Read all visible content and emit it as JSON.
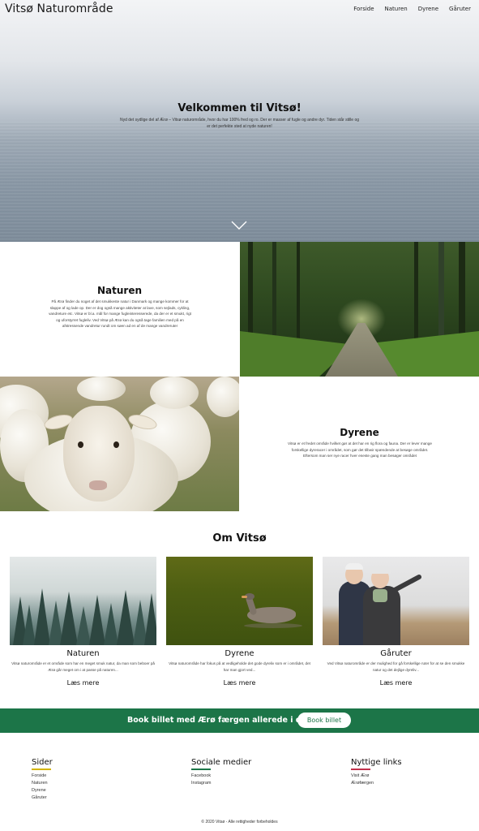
{
  "header": {
    "logo": "Vitsø Naturområde",
    "nav": [
      "Forside",
      "Naturen",
      "Dyrene",
      "Gåruter"
    ]
  },
  "hero": {
    "title": "Velkommen til Vitsø!",
    "subtitle": "Nyd det sydlige del af Ærø – Vitsø naturområde, hvor du har 100% fred og ro. Der er masser af fugle og andre dyr. Tiden står stille og er det perfekte sted at nyde naturen!"
  },
  "naturen": {
    "title": "Naturen",
    "text": "På Ærø finder du noget af det smukkeste natur i Danmark og mange kommer for at slappe af og lade op. Der er dog også mange aktiviteter at lave, som sejlads, cykling, vandreture etc. Vitsø er bl.a. mål for mange fugleinteresserede, da der er et smukt, rigt og uforstyrret fugleliv. Ved Vitsø på Ærø kan du også tage familien med på en afstressende vandretur rundt om søen ad en af de mange vandreruter"
  },
  "dyrene": {
    "title": "Dyrene",
    "text": "Vitsø er et fredet område hvilket gør at det har en rig flora og fauna. Der er lever mange forskellige dyreracer i området, som gør det tilbwir spændende at besøge området. Eftersom man ser nye racer hver eneste gang man besøger området"
  },
  "om": {
    "title": "Om Vitsø",
    "cards": [
      {
        "title": "Naturen",
        "text": "Vitsø naturområde er et område som har en meget smuk natur, da man som beboer på Ærø går meget om i at passe på naturen...",
        "link": "Læs mere"
      },
      {
        "title": "Dyrene",
        "text": "Vitsø naturområde har fokus på at vedligeholde det gode dyreliv som er i området, det har man gjort ved...",
        "link": "Læs mere"
      },
      {
        "title": "Gåruter",
        "text": "Ved Vitsø naturområde er der mulighed for gå forskellige ruter for at se den smukke natur og det dejlige dyreliv...",
        "link": "Læs mere"
      }
    ]
  },
  "banner": {
    "text": "Book billet med Ærø færgen allerede i dag!",
    "button": "Book billet"
  },
  "footer": {
    "cols": [
      {
        "title": "Sider",
        "accent": "#d4b400",
        "links": [
          "Forside",
          "Naturen",
          "Dyrene",
          "Gåruter"
        ]
      },
      {
        "title": "Sociale medier",
        "accent": "#1c7548",
        "links": [
          "Facebook",
          "Instagram"
        ]
      },
      {
        "title": "Nyttige links",
        "accent": "#c0304a",
        "links": [
          "Visit Ærø",
          "Ærøfærgen"
        ]
      }
    ],
    "copyright": "© 2020 Vitsø - Alle rettigheder forbeholdes"
  },
  "colors": {
    "banner": "#1c7548",
    "brand_dark": "#111111"
  },
  "icons": {
    "hero_scroll": "chevron-down-icon"
  }
}
